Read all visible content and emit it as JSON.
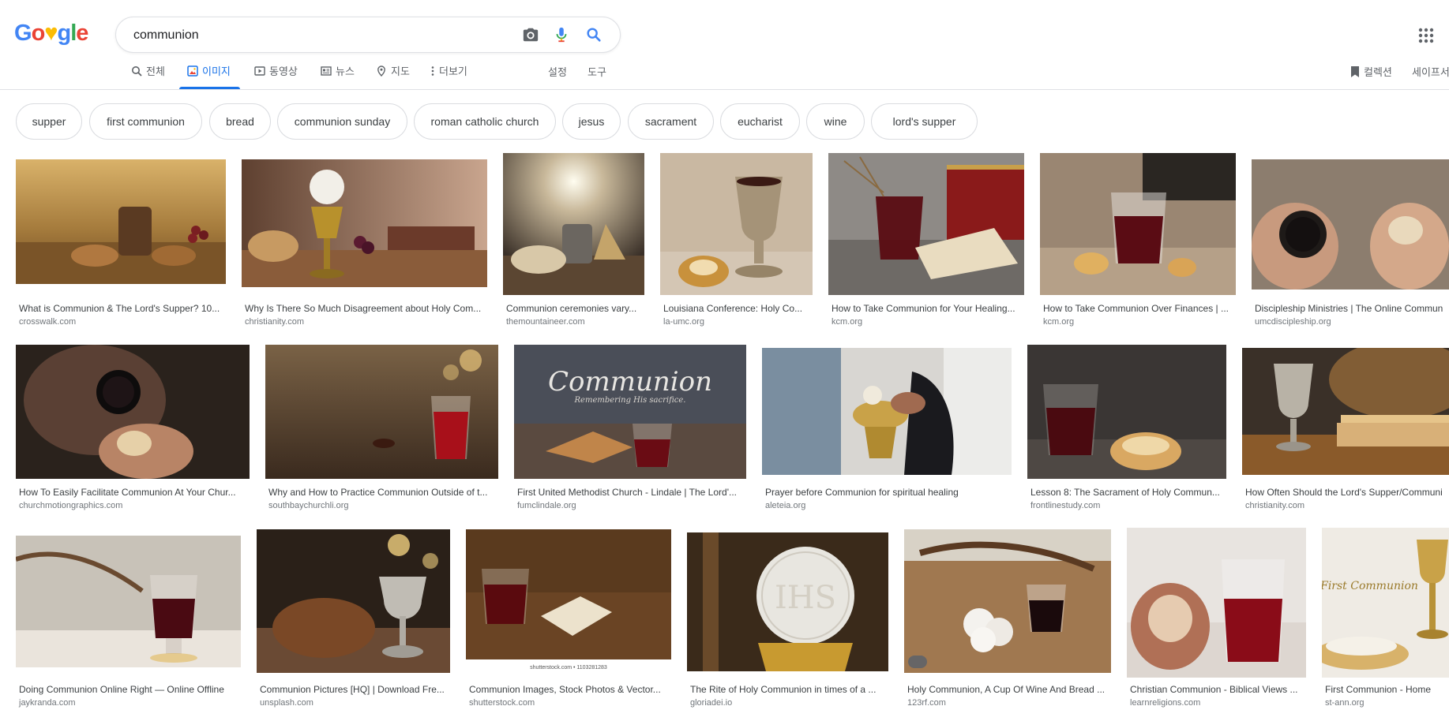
{
  "search": {
    "query": "communion"
  },
  "logo": {
    "text": "Google"
  },
  "tabs": [
    {
      "label": "전체",
      "icon": "search-icon"
    },
    {
      "label": "이미지",
      "icon": "image-icon",
      "active": true
    },
    {
      "label": "동영상",
      "icon": "video-icon"
    },
    {
      "label": "뉴스",
      "icon": "news-icon"
    },
    {
      "label": "지도",
      "icon": "map-pin-icon"
    },
    {
      "label": "더보기",
      "icon": "more-vert-icon"
    }
  ],
  "tools": {
    "settings": "설정",
    "tools": "도구",
    "collections": "컬렉션",
    "safesearch": "세이프서"
  },
  "chips": [
    "supper",
    "first communion",
    "bread",
    "communion sunday",
    "roman catholic church",
    "jesus",
    "sacrament",
    "eucharist",
    "wine",
    "lord's supper"
  ],
  "results": [
    [
      {
        "title": "What is Communion & The Lord's Supper? 10...",
        "domain": "crosswalk.com"
      },
      {
        "title": "Why Is There So Much Disagreement about Holy Com...",
        "domain": "christianity.com"
      },
      {
        "title": "Communion ceremonies vary...",
        "domain": "themountaineer.com"
      },
      {
        "title": "Louisiana Conference: Holy Co...",
        "domain": "la-umc.org"
      },
      {
        "title": "How to Take Communion for Your Healing...",
        "domain": "kcm.org"
      },
      {
        "title": "How to Take Communion Over Finances | ...",
        "domain": "kcm.org"
      },
      {
        "title": "Discipleship Ministries | The Online Commun",
        "domain": "umcdiscipleship.org"
      }
    ],
    [
      {
        "title": "How To Easily Facilitate Communion At Your Chur...",
        "domain": "churchmotiongraphics.com"
      },
      {
        "title": "Why and How to Practice Communion Outside of t...",
        "domain": "southbaychurchli.org"
      },
      {
        "title": "First United Methodist Church - Lindale | The Lord'...",
        "domain": "fumclindale.org",
        "overlay": "Communion",
        "overlay_sub": "Remembering His sacrifice."
      },
      {
        "title": "Prayer before Communion for spiritual healing",
        "domain": "aleteia.org"
      },
      {
        "title": "Lesson 8: The Sacrament of Holy Commun...",
        "domain": "frontlinestudy.com"
      },
      {
        "title": "How Often Should the Lord's Supper/Communi",
        "domain": "christianity.com"
      }
    ],
    [
      {
        "title": "Doing Communion Online Right — Online Offline",
        "domain": "jaykranda.com"
      },
      {
        "title": "Communion Pictures [HQ] | Download Fre...",
        "domain": "unsplash.com"
      },
      {
        "title": "Communion Images, Stock Photos & Vector...",
        "domain": "shutterstock.com",
        "overlay_sub": "shutterstock.com • 1103281283"
      },
      {
        "title": "The Rite of Holy Communion in times of a ...",
        "domain": "gloriadei.io"
      },
      {
        "title": "Holy Communion, A Cup Of Wine And Bread ...",
        "domain": "123rf.com"
      },
      {
        "title": "Christian Communion - Biblical Views ...",
        "domain": "learnreligions.com"
      },
      {
        "title": "First Communion - Home",
        "domain": "st-ann.org",
        "overlay": "First Communion"
      }
    ]
  ]
}
